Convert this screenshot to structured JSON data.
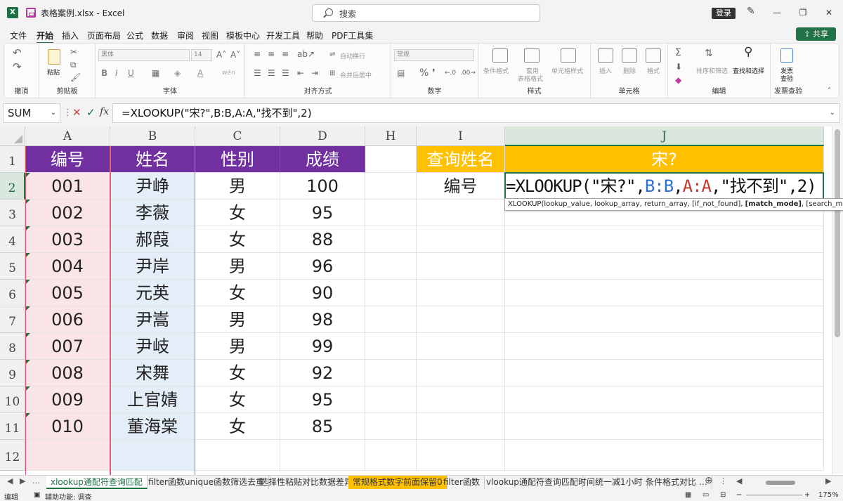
{
  "window": {
    "doc_title": "表格案例.xlsx  -  Excel",
    "search_placeholder": "搜索",
    "login_label": "登录",
    "minimize": "—",
    "restore": "❐",
    "close": "✕"
  },
  "menu": {
    "items": [
      "文件",
      "开始",
      "插入",
      "页面布局",
      "公式",
      "数据",
      "审阅",
      "视图",
      "模板中心",
      "开发工具",
      "帮助",
      "PDF工具集"
    ],
    "active": "开始",
    "share_label": "共享"
  },
  "ribbon": {
    "groups": [
      "撤消",
      "剪贴板",
      "字体",
      "对齐方式",
      "数字",
      "样式",
      "单元格",
      "编辑",
      "发票查验"
    ],
    "paste_label": "粘贴",
    "font_name": "黑体",
    "font_size": "14",
    "wrap_text": "自动换行",
    "merge_center": "合并后居中",
    "number_format": "常规",
    "conditional_format": "条件格式",
    "table_format_1": "套用",
    "table_format_2": "表格格式",
    "cell_styles": "单元格样式",
    "insert": "插入",
    "delete": "删除",
    "format": "格式",
    "sort_filter": "排序和筛选",
    "find_select": "查找和选择",
    "invoice_1": "发票",
    "invoice_2": "查验",
    "bold": "B",
    "italic": "I",
    "underline": "U"
  },
  "formula_bar": {
    "name_box": "SUM",
    "formula": "=XLOOKUP(\"宋?\",B:B,A:A,\"找不到\",2)"
  },
  "columns": [
    "A",
    "B",
    "C",
    "D",
    "H",
    "I",
    "J"
  ],
  "rows": [
    "1",
    "2",
    "3",
    "4",
    "5",
    "6",
    "7",
    "8",
    "9",
    "10",
    "11",
    "12"
  ],
  "table": {
    "headers": [
      "编号",
      "姓名",
      "性别",
      "成绩"
    ],
    "data": [
      [
        "001",
        "尹峥",
        "男",
        "100"
      ],
      [
        "002",
        "李薇",
        "女",
        "95"
      ],
      [
        "003",
        "郝葭",
        "女",
        "88"
      ],
      [
        "004",
        "尹岸",
        "男",
        "96"
      ],
      [
        "005",
        "元英",
        "女",
        "90"
      ],
      [
        "006",
        "尹嵩",
        "男",
        "98"
      ],
      [
        "007",
        "尹岐",
        "男",
        "99"
      ],
      [
        "008",
        "宋舞",
        "女",
        "92"
      ],
      [
        "009",
        "上官婧",
        "女",
        "95"
      ],
      [
        "010",
        "董海棠",
        "女",
        "85"
      ]
    ]
  },
  "lookup": {
    "label": "查询姓名",
    "value": "宋?",
    "result_label": "编号",
    "formula_parts": {
      "p1": "=XLOOKUP(\"宋?\",",
      "p2": "B:B",
      "p3": ",",
      "p4": "A:A",
      "p5": ",\"找不到\",2)"
    }
  },
  "tooltip": {
    "pre": "XLOOKUP(lookup_value, lookup_array, return_array, [if_not_found], ",
    "bold": "[match_mode]",
    "post": ", [search_mode])"
  },
  "sheets": {
    "nav": [
      "◀",
      "▶",
      "…"
    ],
    "tabs": [
      "xlookup通配符查询匹配",
      "filter函数unique函数筛选去重",
      "选择性粘贴对比数据差异",
      "常规格式数字前面保留0",
      "filter函数",
      "vlookup通配符查询匹配",
      "时间统一减1小时",
      "条件格式对比 …"
    ],
    "add": "⊕"
  },
  "status": {
    "mode": "编辑",
    "accessibility": "辅助功能: 调查",
    "zoom": "175%"
  },
  "colors": {
    "excel_green": "#217346",
    "header_purple": "#7030a0",
    "lookup_yellow": "#ffc000",
    "col_a_fill": "#fbe4e8",
    "col_b_fill": "#e4eef8",
    "ref_blue": "#2f6fcf",
    "ref_red": "#c0392b"
  }
}
